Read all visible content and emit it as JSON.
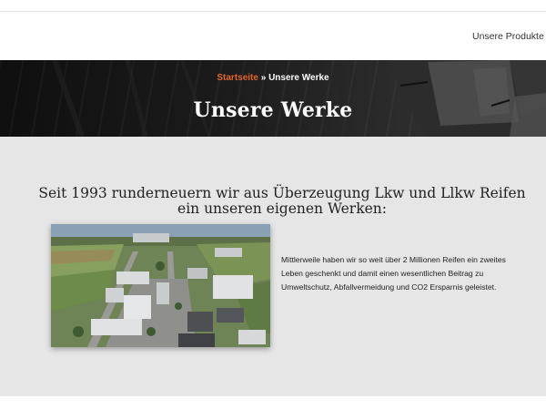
{
  "nav": {
    "item_label": "Unsere Produkte",
    "chevron_icon": "chevron-down-icon"
  },
  "hero": {
    "breadcrumb_home": "Startseite",
    "breadcrumb_separator": " » ",
    "breadcrumb_current": "Unsere Werke",
    "title": "Unsere Werke"
  },
  "main": {
    "heading": "Seit 1993 runderneuern wir aus Überzeugung Lkw und Llkw Reifen ein unseren eigenen Werken:",
    "paragraph": "Mittlerweile haben wir so weit über 2 Millionen Reifen ein zweites Leben geschenkt und damit einen wesentlichen Beitrag zu Umweltschutz, Abfallvermeidung und CO2 Ersparnis geleistet."
  },
  "colors": {
    "accent": "#e0652a",
    "hero_bg": "#1b1b1b",
    "content_bg": "#e6e6e6",
    "text": "#222222"
  }
}
